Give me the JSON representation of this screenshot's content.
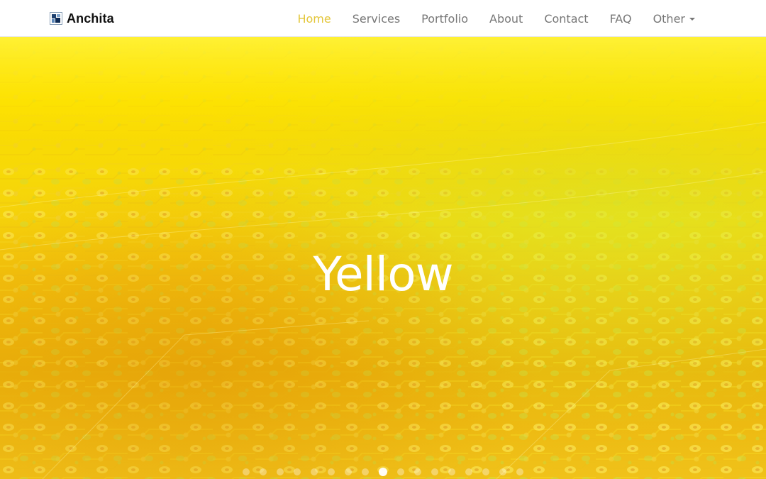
{
  "brand": {
    "name": "Anchita",
    "logo_icon": "brand-logo-icon"
  },
  "nav": {
    "items": [
      {
        "label": "Home",
        "active": true
      },
      {
        "label": "Services",
        "active": false
      },
      {
        "label": "Portfolio",
        "active": false
      },
      {
        "label": "About",
        "active": false
      },
      {
        "label": "Contact",
        "active": false
      },
      {
        "label": "FAQ",
        "active": false
      },
      {
        "label": "Other",
        "active": false,
        "dropdown": true
      }
    ]
  },
  "hero": {
    "title": "Yellow",
    "background": "circuit-board-image",
    "slide_count": 17,
    "active_slide": 9
  },
  "colors": {
    "active_nav": "#e3c63a",
    "nav_text": "#777777",
    "hero_yellow": "#ffe600",
    "hero_orange": "#eab20a",
    "hero_title": "#ffffff"
  }
}
